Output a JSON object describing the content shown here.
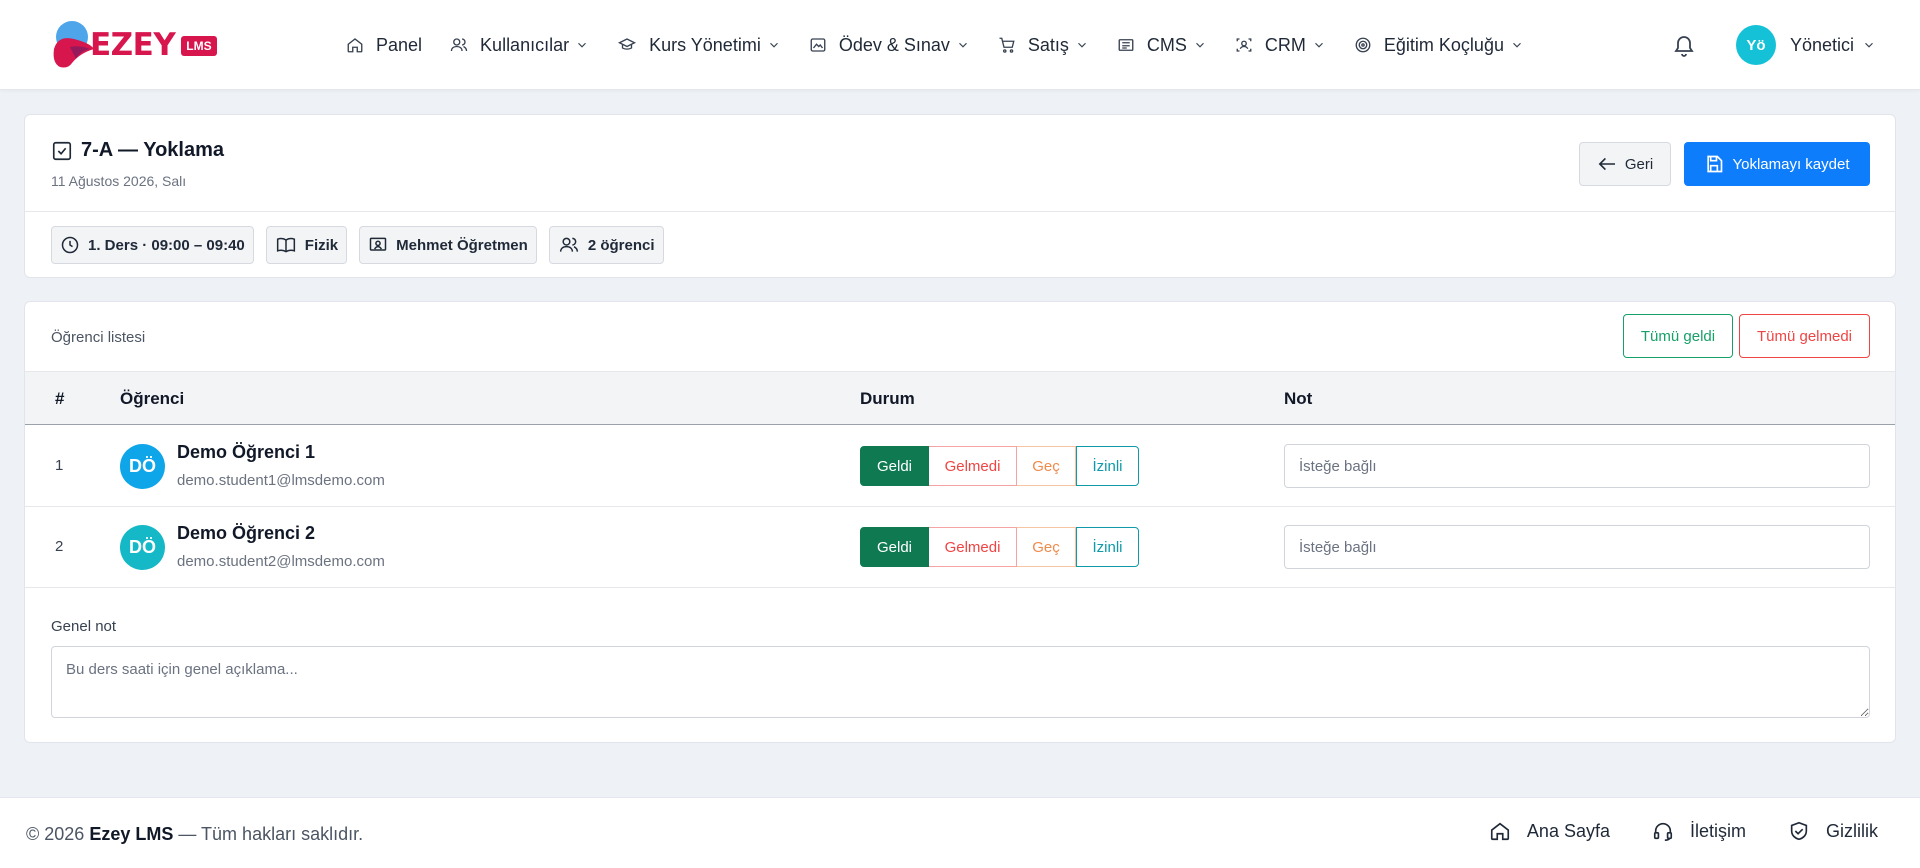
{
  "brand": {
    "name": "EZEY",
    "badge": "LMS",
    "primary_color": "#d8164e"
  },
  "nav": {
    "items": [
      {
        "label": "Panel",
        "icon": "home-icon",
        "dropdown": false
      },
      {
        "label": "Kullanıcılar",
        "icon": "users-icon",
        "dropdown": true
      },
      {
        "label": "Kurs Yönetimi",
        "icon": "graduation-cap-icon",
        "dropdown": true
      },
      {
        "label": "Ödev & Sınav",
        "icon": "image-icon",
        "dropdown": true
      },
      {
        "label": "Satış",
        "icon": "cart-icon",
        "dropdown": true
      },
      {
        "label": "CMS",
        "icon": "newspaper-icon",
        "dropdown": true
      },
      {
        "label": "CRM",
        "icon": "scan-user-icon",
        "dropdown": true
      },
      {
        "label": "Eğitim Koçluğu",
        "icon": "target-icon",
        "dropdown": true
      }
    ],
    "user": {
      "initials": "Yö",
      "name": "Yönetici",
      "avatar_color": "#14c1d6"
    }
  },
  "attendance": {
    "title": "7-A — Yoklama",
    "date": "11 Ağustos 2026, Salı",
    "back_label": "Geri",
    "save_label": "Yoklamayı kaydet",
    "chips": {
      "period": "1. Ders · 09:00 – 09:40",
      "subject": "Fizik",
      "teacher": "Mehmet Öğretmen",
      "count": "2 öğrenci"
    }
  },
  "list": {
    "label": "Öğrenci listesi",
    "all_present": "Tümü geldi",
    "all_absent": "Tümü gelmedi",
    "columns": {
      "num": "#",
      "student": "Öğrenci",
      "status": "Durum",
      "note": "Not"
    },
    "status_options": [
      "Geldi",
      "Gelmedi",
      "Geç",
      "İzinli"
    ],
    "note_placeholder": "İsteğe bağlı",
    "rows": [
      {
        "num": "1",
        "initials": "DÖ",
        "name": "Demo Öğrenci 1",
        "email": "demo.student1@lmsdemo.com",
        "status": "Geldi",
        "avatar_color": "#0ea5e9"
      },
      {
        "num": "2",
        "initials": "DÖ",
        "name": "Demo Öğrenci 2",
        "email": "demo.student2@lmsdemo.com",
        "status": "Geldi",
        "avatar_color": "#14b8c6"
      }
    ],
    "general_note_label": "Genel not",
    "general_note_placeholder": "Bu ders saati için genel açıklama..."
  },
  "footer": {
    "year": "© 2026",
    "brand": "Ezey LMS",
    "rights": "— Tüm hakları saklıdır.",
    "links": [
      {
        "label": "Ana Sayfa",
        "icon": "home-icon"
      },
      {
        "label": "İletişim",
        "icon": "headset-icon"
      },
      {
        "label": "Gizlilik",
        "icon": "shield-check-icon"
      }
    ]
  }
}
